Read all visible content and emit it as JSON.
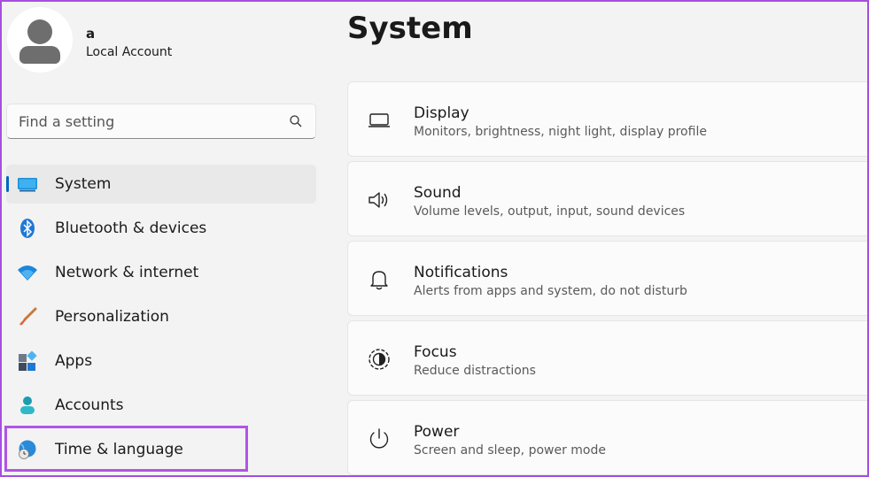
{
  "user": {
    "name": "a",
    "account_type": "Local Account"
  },
  "search": {
    "placeholder": "Find a setting"
  },
  "nav": {
    "items": [
      {
        "label": "System",
        "icon": "system-icon",
        "active": true
      },
      {
        "label": "Bluetooth & devices",
        "icon": "bluetooth-icon"
      },
      {
        "label": "Network & internet",
        "icon": "wifi-icon"
      },
      {
        "label": "Personalization",
        "icon": "brush-icon"
      },
      {
        "label": "Apps",
        "icon": "apps-icon"
      },
      {
        "label": "Accounts",
        "icon": "accounts-icon"
      },
      {
        "label": "Time & language",
        "icon": "time-language-icon",
        "highlighted": true
      }
    ]
  },
  "main": {
    "title": "System",
    "cards": [
      {
        "title": "Display",
        "subtitle": "Monitors, brightness, night light, display profile",
        "icon": "display-icon"
      },
      {
        "title": "Sound",
        "subtitle": "Volume levels, output, input, sound devices",
        "icon": "speaker-icon"
      },
      {
        "title": "Notifications",
        "subtitle": "Alerts from apps and system, do not disturb",
        "icon": "bell-icon"
      },
      {
        "title": "Focus",
        "subtitle": "Reduce distractions",
        "icon": "focus-icon"
      },
      {
        "title": "Power",
        "subtitle": "Screen and sleep, power mode",
        "icon": "power-icon"
      }
    ]
  },
  "colors": {
    "accent": "#0067c0",
    "highlight": "#b155e6"
  }
}
